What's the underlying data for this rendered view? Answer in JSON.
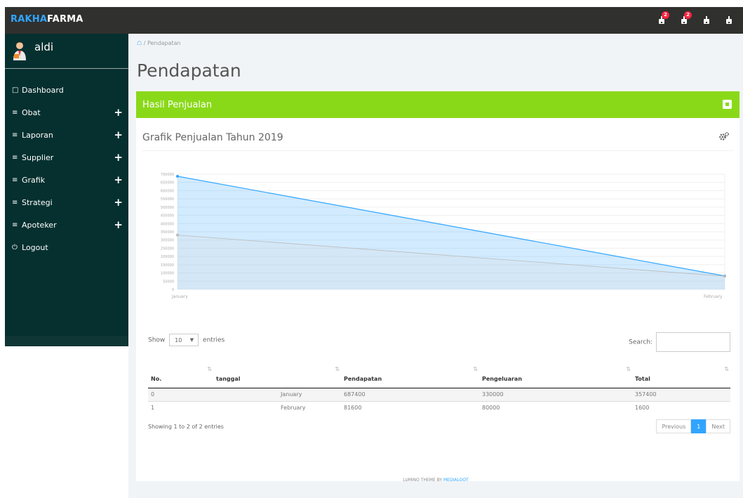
{
  "brand": {
    "part1": "RAKHA",
    "part2": "FARMA"
  },
  "topbar": {
    "notifications": [
      {
        "icon": "alert-icon",
        "badge": "2"
      },
      {
        "icon": "alert-icon",
        "badge": "2"
      },
      {
        "icon": "alert-icon",
        "badge": ""
      },
      {
        "icon": "alert-icon",
        "badge": ""
      }
    ]
  },
  "user": {
    "name": "aldi"
  },
  "sidebar": {
    "items": [
      {
        "icon": "□",
        "label": "Dashboard",
        "expand": ""
      },
      {
        "icon": "≡",
        "label": "Obat",
        "expand": "+"
      },
      {
        "icon": "≡",
        "label": "Laporan",
        "expand": "+"
      },
      {
        "icon": "≡",
        "label": "Supplier",
        "expand": "+"
      },
      {
        "icon": "≡",
        "label": "Grafik",
        "expand": "+"
      },
      {
        "icon": "≡",
        "label": "Strategi",
        "expand": "+"
      },
      {
        "icon": "≡",
        "label": "Apoteker",
        "expand": "+"
      },
      {
        "icon": "⏻",
        "label": "Logout",
        "expand": ""
      }
    ]
  },
  "breadcrumb": {
    "current": "Pendapatan"
  },
  "page": {
    "title": "Pendapatan"
  },
  "panel": {
    "title": "Hasil Penjualan"
  },
  "chart_title": "Grafik Penjualan Tahun 2019",
  "chart_data": {
    "type": "area",
    "categories": [
      "January",
      "February"
    ],
    "series": [
      {
        "values": [
          687400,
          81600
        ],
        "color": "#30a5ff"
      },
      {
        "values": [
          330000,
          80000
        ],
        "color": "#bbbbbb"
      }
    ],
    "ylim": [
      0,
      700000
    ],
    "yticks": [
      0,
      50000,
      100000,
      150000,
      200000,
      250000,
      300000,
      350000,
      400000,
      450000,
      500000,
      550000,
      600000,
      650000,
      700000
    ],
    "grid": true
  },
  "datatable": {
    "show_label": "Show",
    "entries_value": "10",
    "entries_label": "entries",
    "search_label": "Search:",
    "columns": [
      "No.",
      "tanggal",
      "Pendapatan",
      "Pengeluaran",
      "Total"
    ],
    "rows": [
      [
        "0",
        "January",
        "687400",
        "330000",
        "357400"
      ],
      [
        "1",
        "February",
        "81600",
        "80000",
        "1600"
      ]
    ],
    "info": "Showing 1 to 2 of 2 entries",
    "prev": "Previous",
    "page": "1",
    "next": "Next"
  },
  "footer": {
    "text": "LUMINO THEME BY ",
    "link": "MEDIALOOT"
  },
  "colors": {
    "accent": "#30a5ff",
    "panel_head": "#8ad919",
    "sidebar": "#05302f"
  }
}
